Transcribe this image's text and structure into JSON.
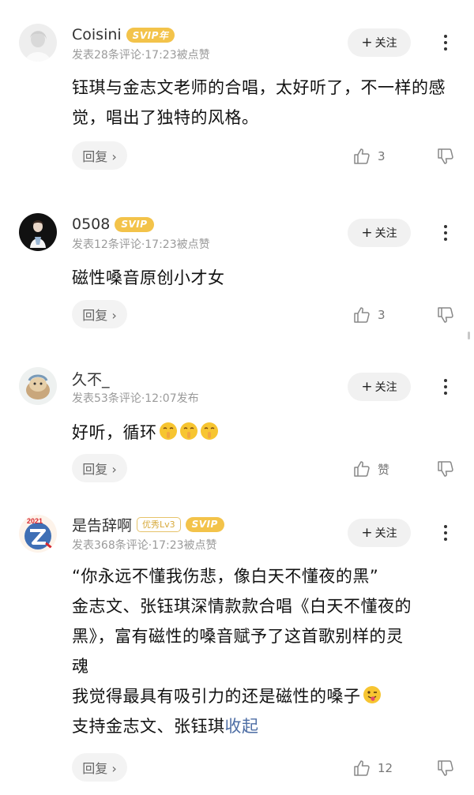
{
  "comments": [
    {
      "username": "Coisini",
      "svip_label": "SVIP年",
      "meta": "发表28条评论·17:23被点赞",
      "follow_label": "关注",
      "content": [
        "钰琪与金志文老师的合唱，太好听了，不一样的感觉，唱出了独特的风格。"
      ],
      "reply_label": "回复 ›",
      "like_count": "3"
    },
    {
      "username": "0508",
      "svip_label": "SVIP",
      "meta": "发表12条评论·17:23被点赞",
      "follow_label": "关注",
      "content": [
        "磁性嗓音原创小才女"
      ],
      "reply_label": "回复 ›",
      "like_count": "3"
    },
    {
      "username": "久不_",
      "meta": "发表53条评论·12:07发布",
      "follow_label": "关注",
      "content": [
        "好听，循环"
      ],
      "reply_label": "回复 ›",
      "like_count": "赞"
    },
    {
      "username": "是告辞啊",
      "level_badge": "优秀Lv3",
      "svip_label": "SVIP",
      "meta": "发表368条评论·17:23被点赞",
      "follow_label": "关注",
      "content": [
        "“你永远不懂我伤悲，像白天不懂夜的黑”",
        "金志文、张钰琪深情款款合唱《白天不懂夜的",
        "黑》，富有磁性的嗓音赋予了这首歌别样的灵",
        "魂",
        "我觉得最具有吸引力的还是磁性的嗓子",
        "支持金志文、张钰琪"
      ],
      "collapse_label": "收起",
      "reply_label": "回复 ›",
      "like_count": "12"
    }
  ],
  "icons": {
    "follow_plus": "+",
    "more": "more-vertical-icon",
    "like": "thumbs-up-icon",
    "dislike": "thumbs-down-icon"
  },
  "colors": {
    "svip": "#f3c34a",
    "collapse_link": "#4e6ea5",
    "meta_text": "#9a9a9a"
  }
}
